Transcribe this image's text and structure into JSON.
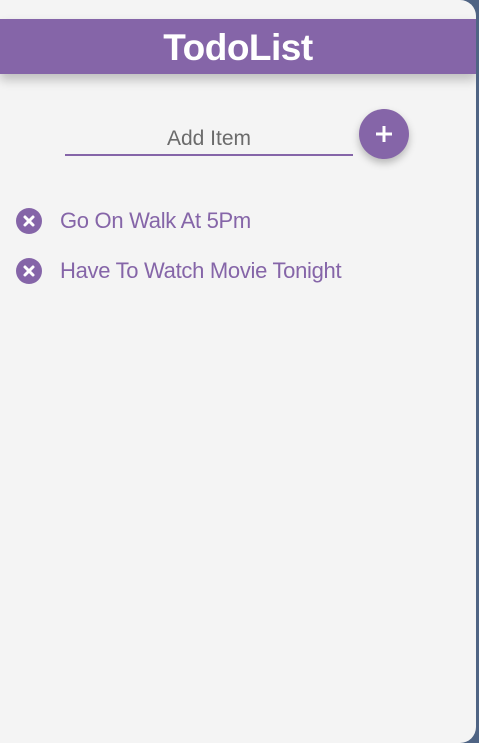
{
  "app": {
    "title": "TodoList"
  },
  "add_form": {
    "placeholder": "Add Item",
    "value": "",
    "add_button_icon": "plus-icon"
  },
  "todos": [
    {
      "text": "Go On Walk At 5Pm",
      "delete_icon": "close-circle-icon"
    },
    {
      "text": "Have To Watch Movie Tonight",
      "delete_icon": "close-circle-icon"
    }
  ],
  "colors": {
    "accent": "#8565a8",
    "background": "#f4f4f4",
    "page_backdrop": "#4f6484",
    "header_text": "#ffffff"
  }
}
